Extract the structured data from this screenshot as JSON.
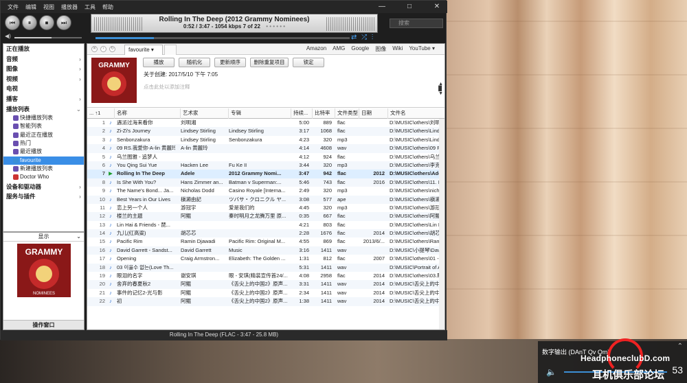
{
  "menu": [
    "文件",
    "编辑",
    "视图",
    "播放器",
    "工具",
    "帮助"
  ],
  "window_buttons": [
    "—",
    "□",
    "✕"
  ],
  "transport": {
    "prev": "⏮",
    "pause": "⏸",
    "stop": "⏹",
    "next": "⏭"
  },
  "now_playing": {
    "title": "Rolling In The Deep (2012 Grammy Nominees)",
    "info": "0:52 / 3:47 - 1054 kbps   7 of 22",
    "dots": "• • • • • •",
    "progress": 0.23
  },
  "search": {
    "placeholder": "搜索"
  },
  "volume_level": 0.55,
  "sidebar": {
    "headers": [
      {
        "label": "正在播放"
      },
      {
        "label": "音频"
      },
      {
        "label": "图像"
      },
      {
        "label": "视频"
      },
      {
        "label": "电视"
      },
      {
        "label": "播客"
      },
      {
        "label": "播放列表"
      }
    ],
    "playlists": [
      {
        "label": "快捷播放列表",
        "color": "#6a4fb0"
      },
      {
        "label": "智能列表",
        "color": "#6a4fb0"
      },
      {
        "label": "最近正在播放",
        "color": "#6a4fb0"
      },
      {
        "label": "热门",
        "color": "#6a4fb0"
      },
      {
        "label": "最近播放",
        "color": "#6a4fb0"
      },
      {
        "label": "favourite",
        "color": "#3c8fd6"
      },
      {
        "label": "新建播放列表",
        "color": "#6a4fb0"
      },
      {
        "label": "Doctor Who",
        "color": "#c33"
      }
    ],
    "footer": [
      {
        "label": "设备和驱动器"
      },
      {
        "label": "服务与插件"
      }
    ]
  },
  "art_panel": {
    "header": "显示",
    "footer": "操作窗口",
    "album_text": "GRAMMY",
    "album_sub": "NOMINEES"
  },
  "tab": {
    "label": "favourite ▾"
  },
  "links": [
    "Amazon",
    "AMG",
    "Google",
    "图像",
    "Wiki",
    "YouTube ▾"
  ],
  "info_buttons": [
    "播放",
    "随机化",
    "更新顺序",
    "删除重复项目",
    "锁定"
  ],
  "created": "关于创建: 2017/5/10 下午 7:05",
  "note_placeholder": "点击此处以添加注释",
  "table": {
    "headers": [
      "... ↑1",
      "名称",
      "艺术家",
      "专辑",
      "持续...",
      "比特率",
      "文件类型",
      "日期",
      "文件名"
    ],
    "rows": [
      {
        "n": "1",
        "t": "遇派过海来看你",
        "a": "刘明湘",
        "al": "",
        "d": "5:00",
        "b": "889",
        "ty": "flac",
        "da": "",
        "f": "D:\\MUSIC\\others\\刘明湘"
      },
      {
        "n": "2",
        "t": "Zi-Zi's Journey",
        "a": "Lindsey Stirling",
        "al": "Lindsey Stirling",
        "d": "3:17",
        "b": "1068",
        "ty": "flac",
        "da": "",
        "f": "D:\\MUSIC\\others\\Lindsey"
      },
      {
        "n": "3",
        "t": "Senbonzakura",
        "a": "Lindsey Stirling",
        "al": "Senbonzakura",
        "d": "4:23",
        "b": "320",
        "ty": "mp3",
        "da": "",
        "f": "D:\\MUSIC\\others\\Lindsey"
      },
      {
        "n": "4",
        "t": "09 RS.我愛你-A-lin 黄麗玲",
        "a": "A-lin 黄麗玲",
        "al": "",
        "d": "4:14",
        "b": "4608",
        "ty": "wav",
        "da": "",
        "f": "D:\\MUSIC\\others\\09 RS."
      },
      {
        "n": "5",
        "t": "乌兰图雅 - 追梦人",
        "a": "",
        "al": "",
        "d": "4:12",
        "b": "924",
        "ty": "flac",
        "da": "",
        "f": "D:\\MUSIC\\others\\乌兰图雅"
      },
      {
        "n": "6",
        "t": "You Qing Sui Yue",
        "a": "Hacken Lee",
        "al": "Fu Ke II",
        "d": "3:44",
        "b": "320",
        "ty": "mp3",
        "da": "",
        "f": "D:\\MUSIC\\others\\李克勤"
      },
      {
        "n": "7",
        "t": "Rolling In The Deep",
        "a": "Adele",
        "al": "2012 Grammy Nomi...",
        "d": "3:47",
        "b": "942",
        "ty": "flac",
        "da": "2012",
        "f": "D:\\MUSIC\\others\\Adel"
      },
      {
        "n": "8",
        "t": "Is She With You?",
        "a": "Hans Zimmer an...",
        "al": "Batman v Superman:...",
        "d": "5:46",
        "b": "743",
        "ty": "flac",
        "da": "2016",
        "f": "D:\\MUSIC\\others\\11. Is"
      },
      {
        "n": "9",
        "t": "The Name's Bond... Ja...",
        "a": "Nicholas Dodd",
        "al": "Casino Royale [Interna...",
        "d": "2:49",
        "b": "320",
        "ty": "mp3",
        "da": "",
        "f": "D:\\MUSIC\\others\\nichol"
      },
      {
        "n": "10",
        "t": "Best Years in Our Lives",
        "a": "槇濑由記",
        "al": "ツバサ・クロニクル ヤ...",
        "d": "3:08",
        "b": "577",
        "ty": "ape",
        "da": "",
        "f": "D:\\MUSIC\\others\\槇濑由"
      },
      {
        "n": "11",
        "t": "恋上另一个人",
        "a": "游冠宇",
        "al": "爱是我们的",
        "d": "4:45",
        "b": "320",
        "ty": "mp3",
        "da": "",
        "f": "D:\\MUSIC\\others\\游冠宇"
      },
      {
        "n": "12",
        "t": "楼兰的主题",
        "a": "阿鲲",
        "al": "秦时明月之龙腾万里 原...",
        "d": "0:35",
        "b": "667",
        "ty": "flac",
        "da": "",
        "f": "D:\\MUSIC\\others\\阿鲲 -"
      },
      {
        "n": "13",
        "t": "Lin Hai & Friends - 琵...",
        "a": "",
        "al": "",
        "d": "4:21",
        "b": "803",
        "ty": "flac",
        "da": "",
        "f": "D:\\MUSIC\\others\\Lin Ha"
      },
      {
        "n": "14",
        "t": "九儿(红高粱)",
        "a": "胡芯芯",
        "al": "",
        "d": "2:28",
        "b": "1676",
        "ty": "flac",
        "da": "2014",
        "f": "D:\\MUSIC\\others\\胡芯芯"
      },
      {
        "n": "15",
        "t": "Pacific Rim",
        "a": "Ramin Djawadi",
        "al": "Pacific Rim: Original M...",
        "d": "4:55",
        "b": "869",
        "ty": "flac",
        "da": "2013/6/...",
        "f": "D:\\MUSIC\\others\\Ramin"
      },
      {
        "n": "16",
        "t": "David Garrett - Sandst...",
        "a": "David Garrett",
        "al": "Music",
        "d": "3:16",
        "b": "1411",
        "ty": "wav",
        "da": "",
        "f": "D:\\MUSIC\\小提琴\\David"
      },
      {
        "n": "17",
        "t": "Opening",
        "a": "Craig Armstron...",
        "al": "Elizabeth: The Golden ...",
        "d": "1:31",
        "b": "812",
        "ty": "flac",
        "da": "2007",
        "f": "D:\\MUSIC\\others\\01 - O"
      },
      {
        "n": "18",
        "t": "03 이울수 없는(Love Th...",
        "a": "",
        "al": "",
        "d": "5:31",
        "b": "1411",
        "ty": "wav",
        "da": "",
        "f": "D:\\MUSIC\\Portrait of A"
      },
      {
        "n": "19",
        "t": "眼泪的名字",
        "a": "谢安琪",
        "al": "眼 - 安琪(精装宣传首24/...",
        "d": "4:08",
        "b": "2958",
        "ty": "flac",
        "da": "2014",
        "f": "D:\\MUSIC\\others\\03.眼泪"
      },
      {
        "n": "20",
        "t": "舍弃的春夏秋2",
        "a": "阿鲲",
        "al": "《舌尖上的中国2》原声...",
        "d": "3:31",
        "b": "1411",
        "ty": "wav",
        "da": "2014",
        "f": "D:\\MUSIC\\舌尖上的中国"
      },
      {
        "n": "21",
        "t": "事件的记忆2-光与影",
        "a": "阿鲲",
        "al": "《舌尖上的中国2》原声...",
        "d": "2:34",
        "b": "1411",
        "ty": "wav",
        "da": "2014",
        "f": "D:\\MUSIC\\舌尖上的中国"
      },
      {
        "n": "22",
        "t": "初",
        "a": "阿鲲",
        "al": "《舌尖上的中国2》原声...",
        "d": "1:38",
        "b": "1411",
        "ty": "wav",
        "da": "2014",
        "f": "D:\\MUSIC\\舌尖上的中国"
      }
    ]
  },
  "status": "Rolling In The Deep (FLAC - 3:47 - 25.8 MB)",
  "device": {
    "name": "数字输出 (DAnT Qv Qm)",
    "volume": "53"
  },
  "watermark": {
    "line1": "HeadphoneclubD.com",
    "line2": "耳机俱乐部论坛"
  },
  "colors": {
    "accent": "#3c8fd6",
    "selected": "#3a8ee6"
  }
}
